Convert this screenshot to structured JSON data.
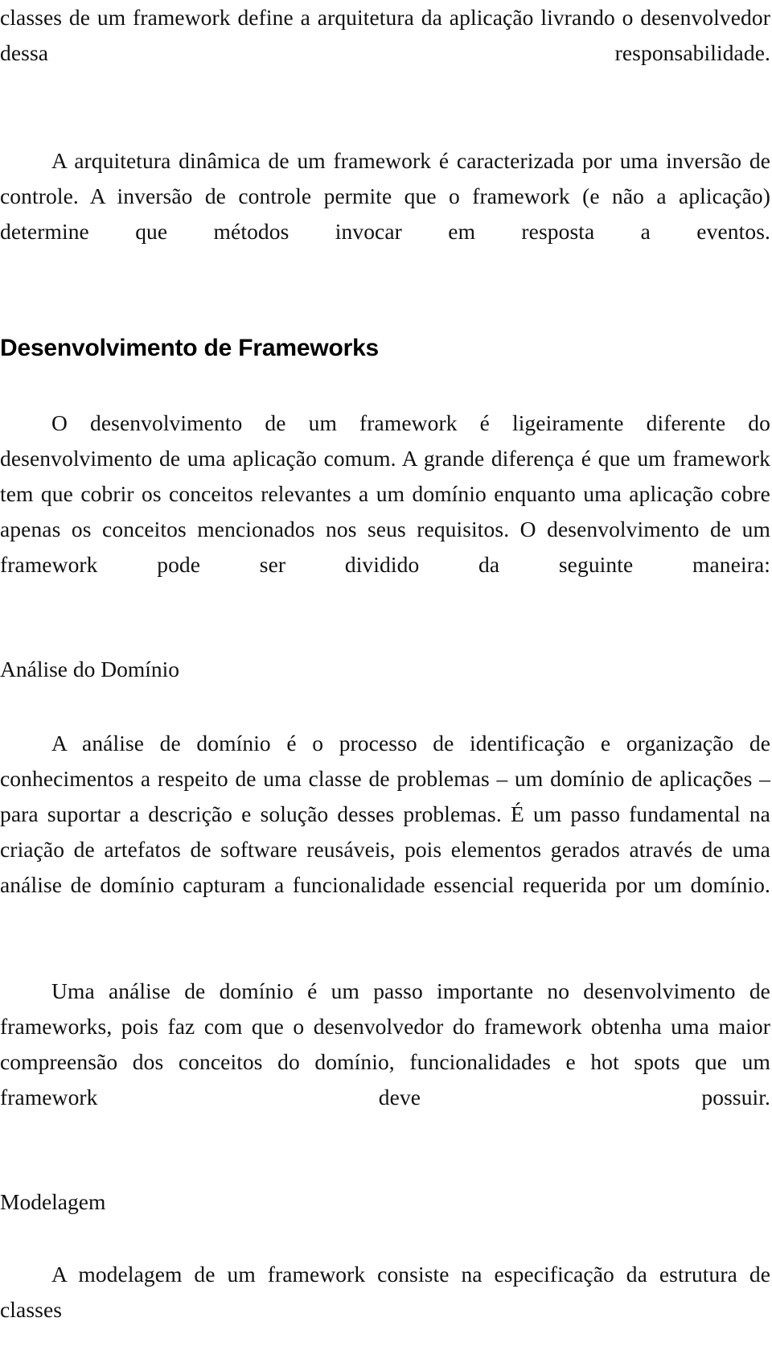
{
  "document": {
    "language": "pt-BR",
    "page_background": "#ffffff",
    "text_color": "#111111",
    "heading_color": "#000000"
  },
  "blocks": {
    "para_continuation": "classes de um framework define a arquitetura da aplicação livrando o desenvolvedor dessa responsabilidade.",
    "para_inversao_controle": "A arquitetura dinâmica de um framework é caracterizada por uma inversão de controle. A inversão de controle permite que o framework (e não a aplicação) determine que métodos invocar em resposta a eventos.",
    "heading_desenvolvimento": "Desenvolvimento de Frameworks",
    "para_desenvolvimento_intro": "O desenvolvimento de um framework é ligeiramente diferente do desenvolvimento de uma aplicação comum. A grande diferença é que um framework tem que cobrir os conceitos relevantes a um domínio enquanto uma aplicação cobre apenas os conceitos mencionados nos seus requisitos. O desenvolvimento de um framework pode ser dividido da seguinte maneira:",
    "subheading_analise_dominio": "Análise do Domínio",
    "para_analise_dominio_1": "A análise de domínio é o processo de identificação e organização de conhecimentos a respeito de uma classe de problemas – um domínio de aplicações – para suportar a descrição e solução desses problemas. É um passo fundamental na criação de artefatos de software reusáveis, pois elementos gerados através de uma análise de domínio capturam a funcionalidade essencial requerida por um domínio.",
    "para_analise_dominio_2": "Uma análise de domínio é um passo importante no desenvolvimento de frameworks, pois faz com que o desenvolvedor do framework obtenha uma maior compreensão dos conceitos do domínio, funcionalidades e hot spots que um framework deve possuir.",
    "subheading_modelagem": "Modelagem",
    "para_modelagem": "A modelagem de um framework consiste na especificação da estrutura de classes"
  }
}
